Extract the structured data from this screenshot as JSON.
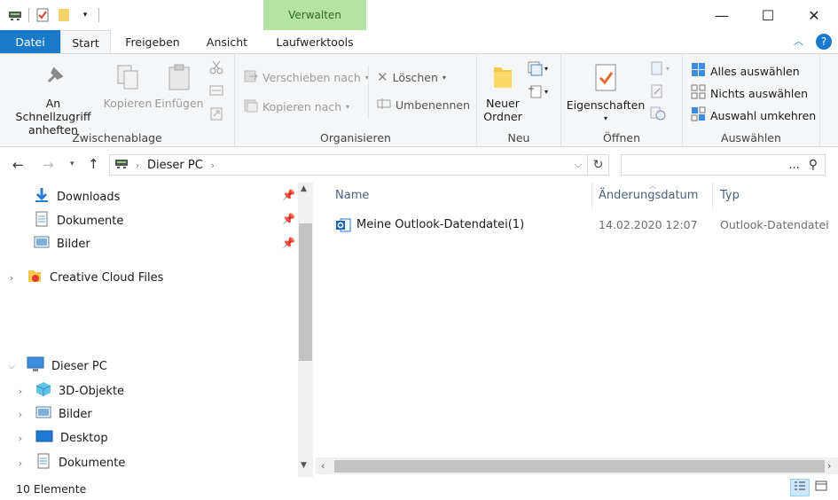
{
  "titlebar": {
    "context_tab": "Verwalten",
    "minimize": "—",
    "maximize": "☐",
    "close": "✕"
  },
  "tabs": {
    "datei": "Datei",
    "start": "Start",
    "freigeben": "Freigeben",
    "ansicht": "Ansicht",
    "laufwerktools": "Laufwerktools",
    "help": "?"
  },
  "ribbon": {
    "zwischenablage": {
      "label": "Zwischenablage",
      "pin": "An Schnellzugriff anheften",
      "pin1": "An Schnellzugriff",
      "pin2": "anheften",
      "kopieren": "Kopieren",
      "einfuegen": "Einfügen"
    },
    "organisieren": {
      "label": "Organisieren",
      "verschieben": "Verschieben nach",
      "kopieren_nach": "Kopieren nach",
      "loeschen": "Löschen",
      "umbenennen": "Umbenennen"
    },
    "neu": {
      "label": "Neu",
      "ordner1": "Neuer",
      "ordner2": "Ordner"
    },
    "oeffnen": {
      "label": "Öffnen",
      "eigenschaften": "Eigenschaften"
    },
    "auswaehlen": {
      "label": "Auswählen",
      "alle": "Alles auswählen",
      "nichts": "Nichts auswählen",
      "umkehren": "Auswahl umkehren"
    }
  },
  "address": {
    "path": "Dieser PC",
    "search_placeholder": "..."
  },
  "nav": {
    "quick": [
      "Downloads",
      "Dokumente",
      "Bilder"
    ],
    "creative": "Creative Cloud Files",
    "pc": "Dieser PC",
    "pc_children": [
      "3D-Objekte",
      "Bilder",
      "Desktop",
      "Dokumente"
    ]
  },
  "files": {
    "columns": {
      "name": "Name",
      "date": "Änderungsdatum",
      "type": "Typ"
    },
    "rows": [
      {
        "name": "Meine Outlook-Datendatei(1)",
        "date": "14.02.2020 12:07",
        "type": "Outlook-Datendatei"
      }
    ]
  },
  "status": {
    "count": "10 Elemente"
  },
  "colors": {
    "accent": "#1979ca",
    "context": "#b5e3a3",
    "selection": "#cce8ff"
  }
}
